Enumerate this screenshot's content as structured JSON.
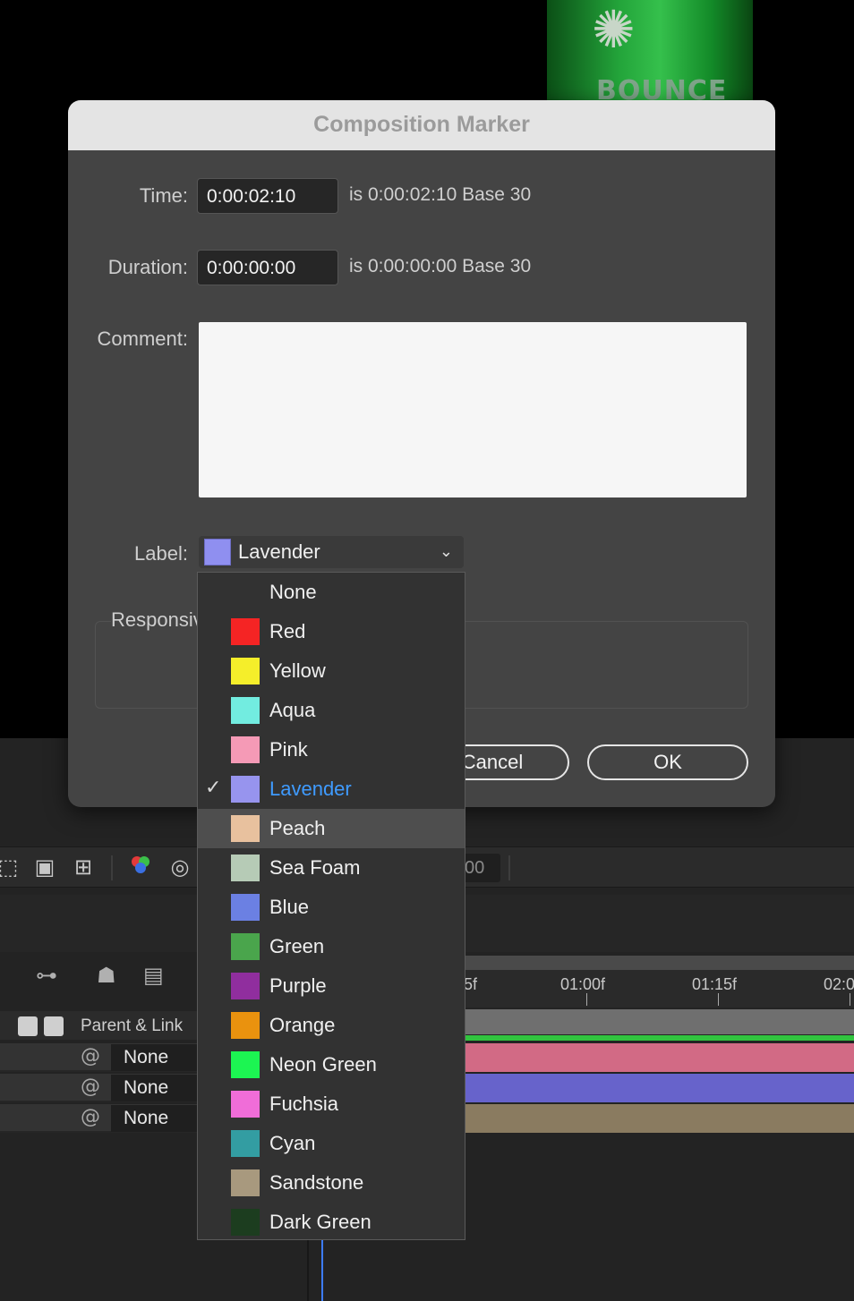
{
  "background": {
    "can_text": "BOUNCE",
    "timecode_fragment": "00",
    "header_label": "Parent & Link",
    "ruler_labels": [
      "5f",
      "01:00f",
      "01:15f",
      "02:0"
    ],
    "layer_parents": [
      "None",
      "None",
      "None"
    ],
    "track_colors": [
      "#d26a85",
      "#6763cb",
      "#8a7b60"
    ]
  },
  "dialog": {
    "title": "Composition Marker",
    "time": {
      "label": "Time:",
      "value": "0:00:02:10",
      "info": "is 0:00:02:10  Base 30"
    },
    "duration": {
      "label": "Duration:",
      "value": "0:00:00:00",
      "info": "is 0:00:00:00  Base 30"
    },
    "comment": {
      "label": "Comment:",
      "value": ""
    },
    "label": {
      "label": "Label:",
      "selected": "Lavender",
      "selected_color": "#8f8ff0"
    },
    "responsive_label": "Responsiv",
    "cancel_label": "Cancel",
    "ok_label": "OK"
  },
  "dropdown": {
    "items": [
      {
        "name": "None",
        "color": ""
      },
      {
        "name": "Red",
        "color": "#f52424"
      },
      {
        "name": "Yellow",
        "color": "#f5ee2a"
      },
      {
        "name": "Aqua",
        "color": "#72ece0"
      },
      {
        "name": "Pink",
        "color": "#f59ab6"
      },
      {
        "name": "Lavender",
        "color": "#9794ee"
      },
      {
        "name": "Peach",
        "color": "#e8c19e"
      },
      {
        "name": "Sea Foam",
        "color": "#b6cbb6"
      },
      {
        "name": "Blue",
        "color": "#6b80e3"
      },
      {
        "name": "Green",
        "color": "#4aa54c"
      },
      {
        "name": "Purple",
        "color": "#902e9e"
      },
      {
        "name": "Orange",
        "color": "#ea920e"
      },
      {
        "name": "Neon Green",
        "color": "#1cf552"
      },
      {
        "name": "Fuchsia",
        "color": "#f06dd8"
      },
      {
        "name": "Cyan",
        "color": "#339da2"
      },
      {
        "name": "Sandstone",
        "color": "#a8997e"
      },
      {
        "name": "Dark Green",
        "color": "#1c3d1f"
      }
    ],
    "selected": "Lavender",
    "hovered": "Peach"
  }
}
